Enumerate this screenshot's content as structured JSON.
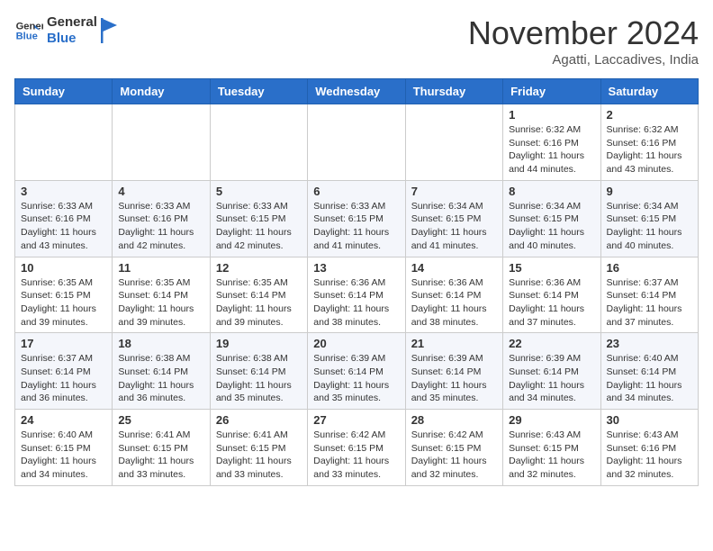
{
  "header": {
    "logo_line1": "General",
    "logo_line2": "Blue",
    "month": "November 2024",
    "location": "Agatti, Laccadives, India"
  },
  "weekdays": [
    "Sunday",
    "Monday",
    "Tuesday",
    "Wednesday",
    "Thursday",
    "Friday",
    "Saturday"
  ],
  "weeks": [
    [
      {
        "day": "",
        "info": ""
      },
      {
        "day": "",
        "info": ""
      },
      {
        "day": "",
        "info": ""
      },
      {
        "day": "",
        "info": ""
      },
      {
        "day": "",
        "info": ""
      },
      {
        "day": "1",
        "info": "Sunrise: 6:32 AM\nSunset: 6:16 PM\nDaylight: 11 hours and 44 minutes."
      },
      {
        "day": "2",
        "info": "Sunrise: 6:32 AM\nSunset: 6:16 PM\nDaylight: 11 hours and 43 minutes."
      }
    ],
    [
      {
        "day": "3",
        "info": "Sunrise: 6:33 AM\nSunset: 6:16 PM\nDaylight: 11 hours and 43 minutes."
      },
      {
        "day": "4",
        "info": "Sunrise: 6:33 AM\nSunset: 6:16 PM\nDaylight: 11 hours and 42 minutes."
      },
      {
        "day": "5",
        "info": "Sunrise: 6:33 AM\nSunset: 6:15 PM\nDaylight: 11 hours and 42 minutes."
      },
      {
        "day": "6",
        "info": "Sunrise: 6:33 AM\nSunset: 6:15 PM\nDaylight: 11 hours and 41 minutes."
      },
      {
        "day": "7",
        "info": "Sunrise: 6:34 AM\nSunset: 6:15 PM\nDaylight: 11 hours and 41 minutes."
      },
      {
        "day": "8",
        "info": "Sunrise: 6:34 AM\nSunset: 6:15 PM\nDaylight: 11 hours and 40 minutes."
      },
      {
        "day": "9",
        "info": "Sunrise: 6:34 AM\nSunset: 6:15 PM\nDaylight: 11 hours and 40 minutes."
      }
    ],
    [
      {
        "day": "10",
        "info": "Sunrise: 6:35 AM\nSunset: 6:15 PM\nDaylight: 11 hours and 39 minutes."
      },
      {
        "day": "11",
        "info": "Sunrise: 6:35 AM\nSunset: 6:14 PM\nDaylight: 11 hours and 39 minutes."
      },
      {
        "day": "12",
        "info": "Sunrise: 6:35 AM\nSunset: 6:14 PM\nDaylight: 11 hours and 39 minutes."
      },
      {
        "day": "13",
        "info": "Sunrise: 6:36 AM\nSunset: 6:14 PM\nDaylight: 11 hours and 38 minutes."
      },
      {
        "day": "14",
        "info": "Sunrise: 6:36 AM\nSunset: 6:14 PM\nDaylight: 11 hours and 38 minutes."
      },
      {
        "day": "15",
        "info": "Sunrise: 6:36 AM\nSunset: 6:14 PM\nDaylight: 11 hours and 37 minutes."
      },
      {
        "day": "16",
        "info": "Sunrise: 6:37 AM\nSunset: 6:14 PM\nDaylight: 11 hours and 37 minutes."
      }
    ],
    [
      {
        "day": "17",
        "info": "Sunrise: 6:37 AM\nSunset: 6:14 PM\nDaylight: 11 hours and 36 minutes."
      },
      {
        "day": "18",
        "info": "Sunrise: 6:38 AM\nSunset: 6:14 PM\nDaylight: 11 hours and 36 minutes."
      },
      {
        "day": "19",
        "info": "Sunrise: 6:38 AM\nSunset: 6:14 PM\nDaylight: 11 hours and 35 minutes."
      },
      {
        "day": "20",
        "info": "Sunrise: 6:39 AM\nSunset: 6:14 PM\nDaylight: 11 hours and 35 minutes."
      },
      {
        "day": "21",
        "info": "Sunrise: 6:39 AM\nSunset: 6:14 PM\nDaylight: 11 hours and 35 minutes."
      },
      {
        "day": "22",
        "info": "Sunrise: 6:39 AM\nSunset: 6:14 PM\nDaylight: 11 hours and 34 minutes."
      },
      {
        "day": "23",
        "info": "Sunrise: 6:40 AM\nSunset: 6:14 PM\nDaylight: 11 hours and 34 minutes."
      }
    ],
    [
      {
        "day": "24",
        "info": "Sunrise: 6:40 AM\nSunset: 6:15 PM\nDaylight: 11 hours and 34 minutes."
      },
      {
        "day": "25",
        "info": "Sunrise: 6:41 AM\nSunset: 6:15 PM\nDaylight: 11 hours and 33 minutes."
      },
      {
        "day": "26",
        "info": "Sunrise: 6:41 AM\nSunset: 6:15 PM\nDaylight: 11 hours and 33 minutes."
      },
      {
        "day": "27",
        "info": "Sunrise: 6:42 AM\nSunset: 6:15 PM\nDaylight: 11 hours and 33 minutes."
      },
      {
        "day": "28",
        "info": "Sunrise: 6:42 AM\nSunset: 6:15 PM\nDaylight: 11 hours and 32 minutes."
      },
      {
        "day": "29",
        "info": "Sunrise: 6:43 AM\nSunset: 6:15 PM\nDaylight: 11 hours and 32 minutes."
      },
      {
        "day": "30",
        "info": "Sunrise: 6:43 AM\nSunset: 6:16 PM\nDaylight: 11 hours and 32 minutes."
      }
    ]
  ]
}
